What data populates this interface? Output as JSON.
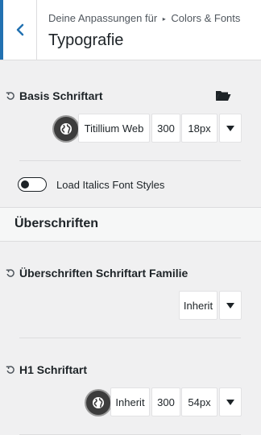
{
  "header": {
    "breadcrumb_prefix": "Deine Anpassungen für",
    "breadcrumb_sep": "▸",
    "breadcrumb_section": "Colors & Fonts",
    "title": "Typografie"
  },
  "base_font": {
    "label": "Basis Schriftart",
    "family": "Titillium Web",
    "weight": "300",
    "size": "18px"
  },
  "italics": {
    "label": "Load Italics Font Styles",
    "enabled": false
  },
  "headings_section": {
    "title": "Überschriften"
  },
  "heading_family": {
    "label": "Überschriften Schriftart Familie",
    "value": "Inherit"
  },
  "h1_font": {
    "label": "H1 Schriftart",
    "family": "Inherit",
    "weight": "300",
    "size": "54px"
  },
  "colors": {
    "accent": "#2271b1",
    "text": "#1d2327",
    "panel_bg": "#f0f0f1"
  }
}
